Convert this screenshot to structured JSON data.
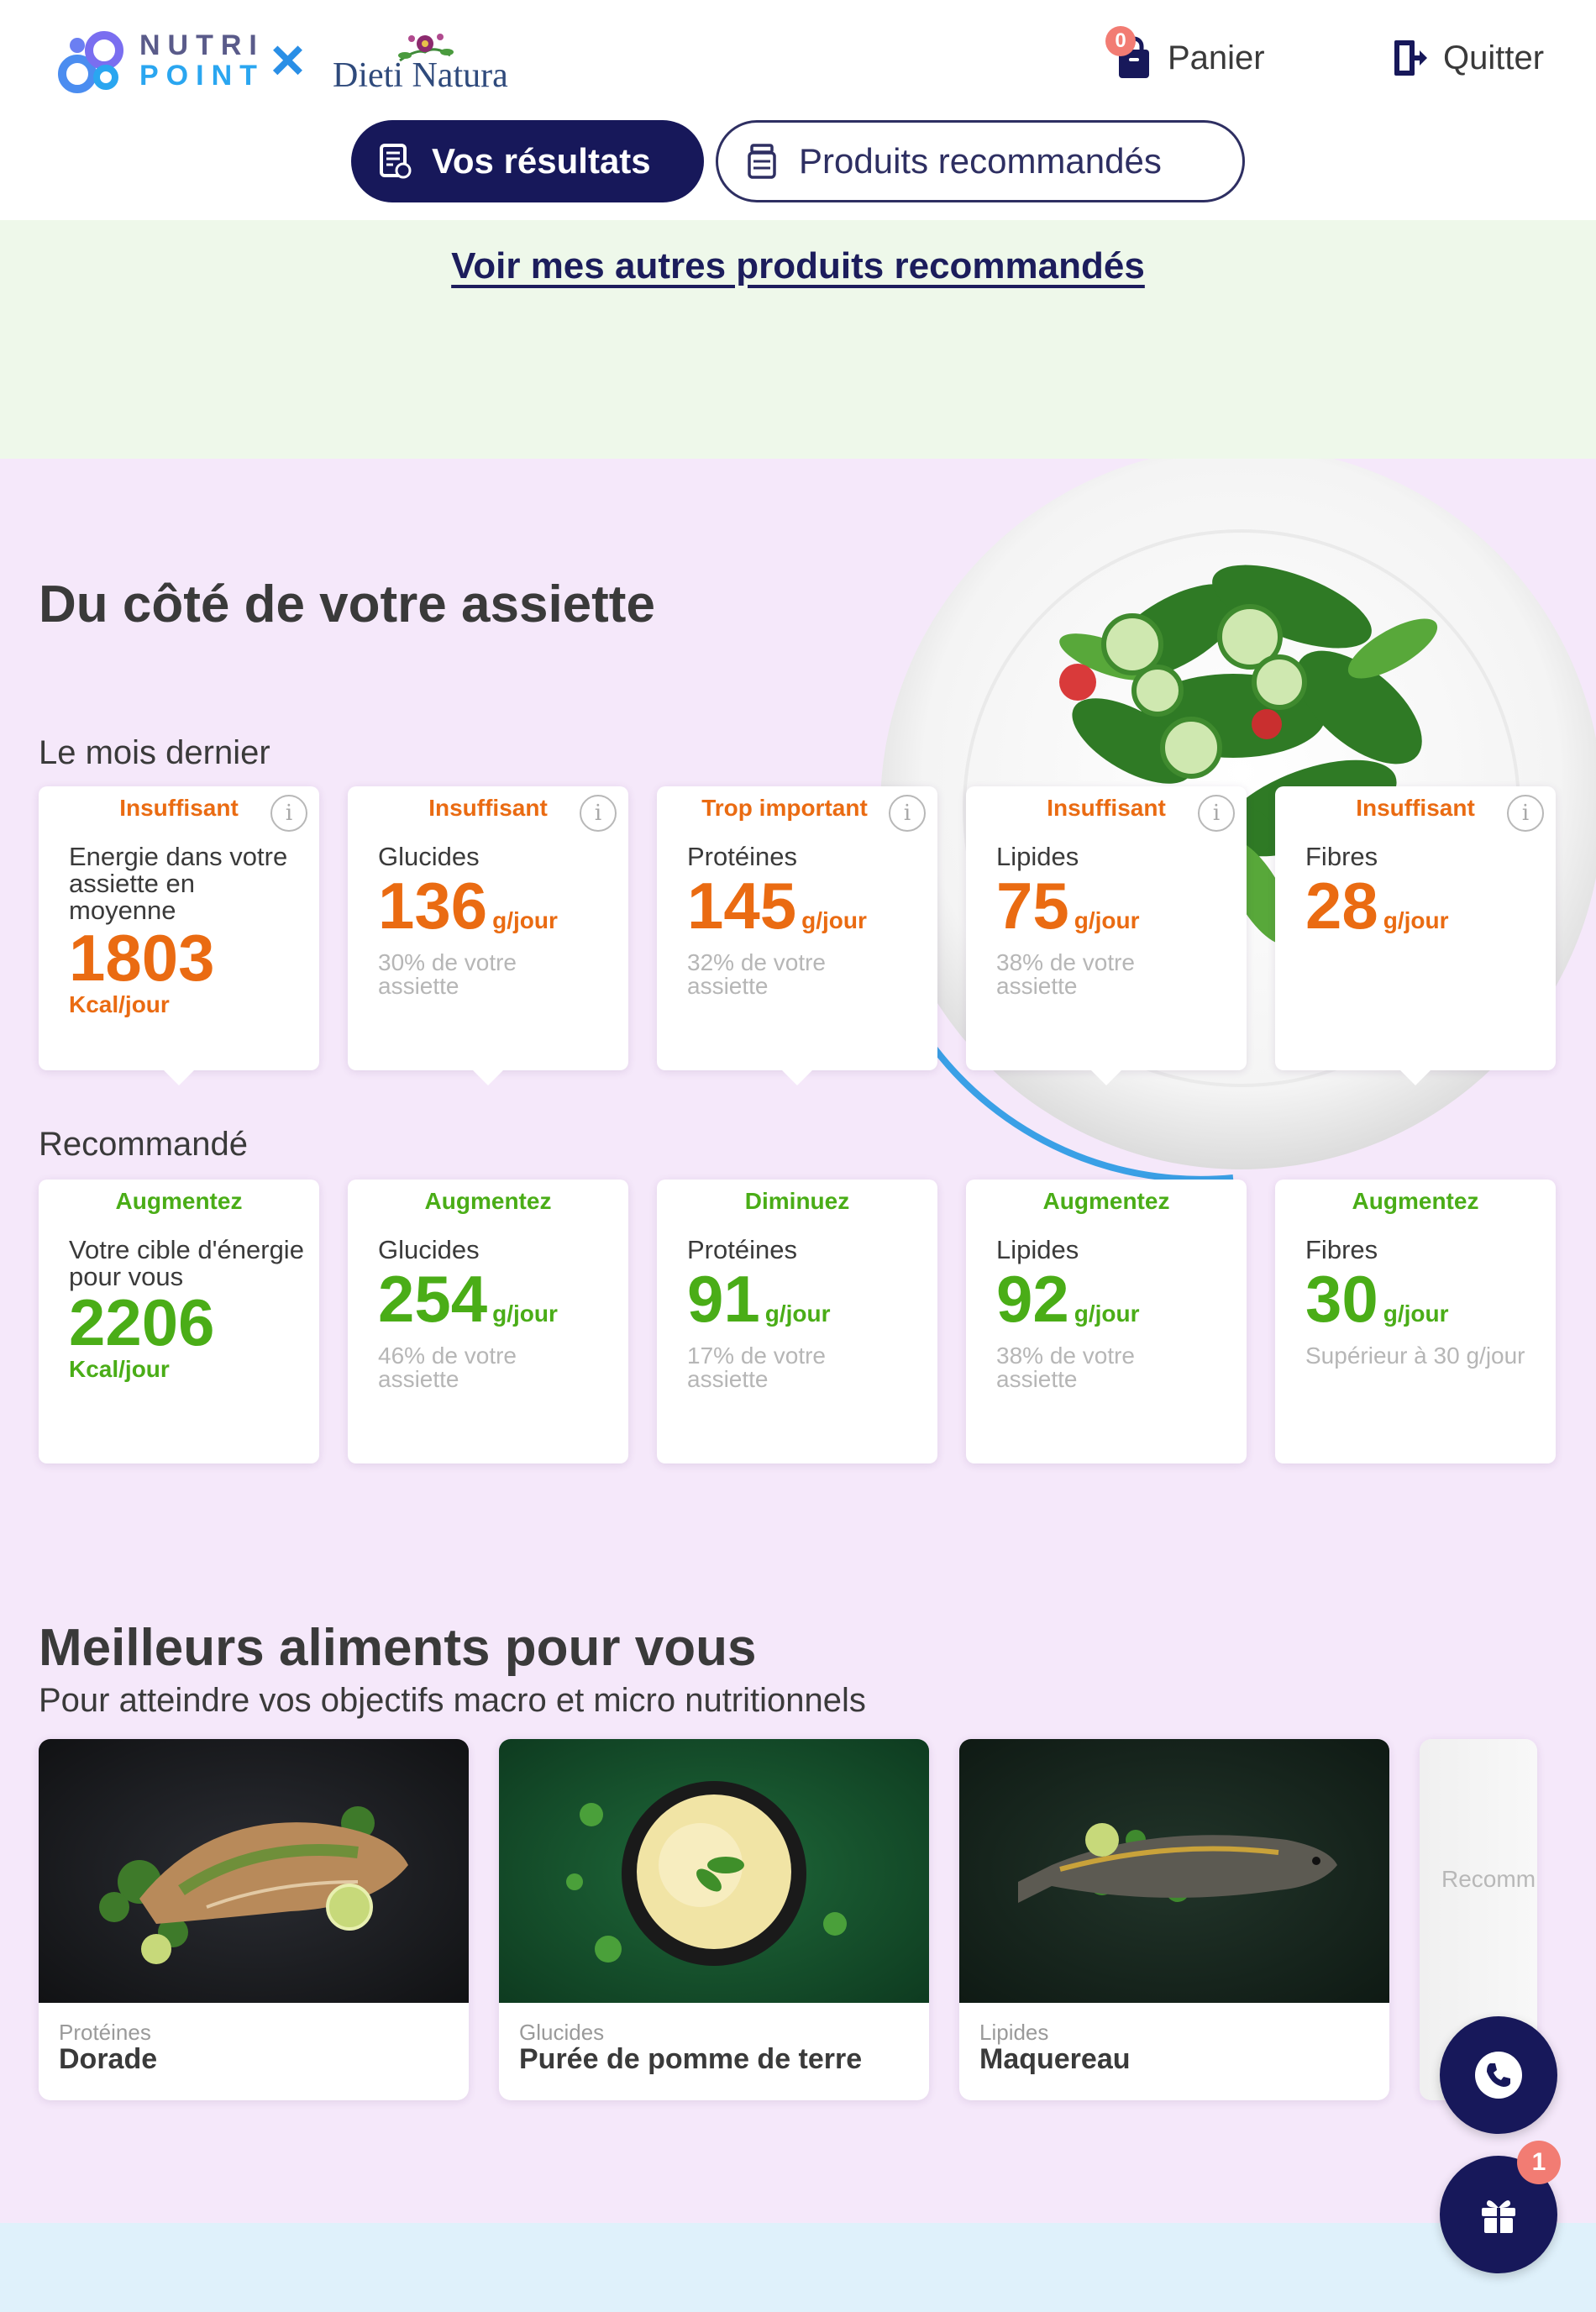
{
  "header": {
    "logo_nutripoint_line1": "NUTRI",
    "logo_nutripoint_line2": "POINT",
    "logo_cross": "×",
    "logo_dietinatura": "Dieti Natura",
    "cart_count": "0",
    "cart_label": "Panier",
    "quit_label": "Quitter"
  },
  "tabs": [
    {
      "label": "Vos résultats",
      "active": true
    },
    {
      "label": "Produits recommandés",
      "active": false
    }
  ],
  "link_other_products": "Voir mes autres produits recommandés",
  "plate_section": {
    "title": "Du côté de votre assiette",
    "last_month_label": "Le mois dernier",
    "recommended_label": "Recommandé",
    "last_month": [
      {
        "status": "Insuffisant",
        "label": "Energie dans votre assiette en moyenne",
        "value": "1803",
        "unit": "Kcal/jour"
      },
      {
        "status": "Insuffisant",
        "label": "Glucides",
        "value": "136",
        "unit": "g/jour",
        "pct": "30% de votre assiette"
      },
      {
        "status": "Trop important",
        "label": "Protéines",
        "value": "145",
        "unit": "g/jour",
        "pct": "32% de votre assiette"
      },
      {
        "status": "Insuffisant",
        "label": "Lipides",
        "value": "75",
        "unit": "g/jour",
        "pct": "38% de votre assiette"
      },
      {
        "status": "Insuffisant",
        "label": "Fibres",
        "value": "28",
        "unit": "g/jour",
        "pct": ""
      }
    ],
    "recommended": [
      {
        "status": "Augmentez",
        "label": "Votre cible d'énergie pour vous",
        "value": "2206",
        "unit": "Kcal/jour"
      },
      {
        "status": "Augmentez",
        "label": "Glucides",
        "value": "254",
        "unit": "g/jour",
        "pct": "46% de votre assiette"
      },
      {
        "status": "Diminuez",
        "label": "Protéines",
        "value": "91",
        "unit": "g/jour",
        "pct": "17% de votre assiette"
      },
      {
        "status": "Augmentez",
        "label": "Lipides",
        "value": "92",
        "unit": "g/jour",
        "pct": "38% de votre assiette"
      },
      {
        "status": "Augmentez",
        "label": "Fibres",
        "value": "30",
        "unit": "g/jour",
        "pct": "Supérieur à 30 g/jour"
      }
    ]
  },
  "foods_section": {
    "title": "Meilleurs aliments pour vous",
    "subtitle": "Pour atteindre vos objectifs macro et micro nutritionnels",
    "items": [
      {
        "category": "Protéines",
        "name": "Dorade"
      },
      {
        "category": "Glucides",
        "name": "Purée de pomme de terre"
      },
      {
        "category": "Lipides",
        "name": "Maquereau"
      }
    ],
    "partial_card_text": "Recomm l'achat"
  },
  "fab": {
    "phone_icon": "phone-icon",
    "gift_icon": "gift-icon",
    "gift_badge": "1"
  },
  "colors": {
    "navy": "#17185a",
    "orange": "#ea6b12",
    "green": "#4aad17",
    "badge": "#f27c73",
    "purple_bg": "#f5e8fa",
    "green_bg": "#eef8ea",
    "blue_bg": "#dff1fb"
  }
}
